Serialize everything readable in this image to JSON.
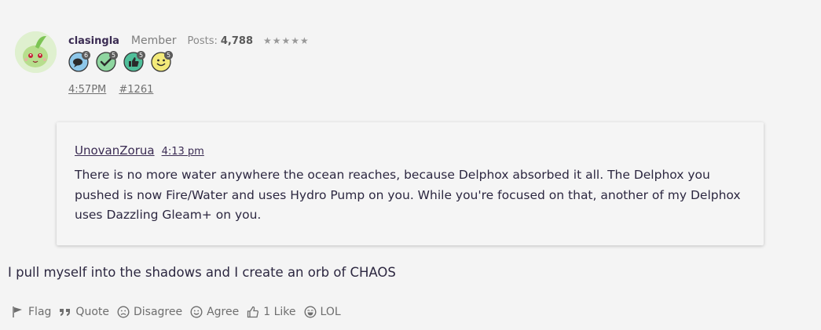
{
  "author": {
    "username": "clasingla",
    "role": "Member",
    "posts_label": "Posts:",
    "posts_value": "4,788",
    "stars": "★★★★★",
    "badges": [
      {
        "icon": "speech-bubble-icon",
        "count": "6",
        "color": "#8ec8ea"
      },
      {
        "icon": "checkmark-icon",
        "count": "5",
        "color": "#8fd6a0"
      },
      {
        "icon": "thumbs-up-icon",
        "count": "5",
        "color": "#4fbf9a"
      },
      {
        "icon": "smiley-face-icon",
        "count": "5",
        "color": "#f3ea7a"
      }
    ]
  },
  "meta": {
    "time": "4:57PM",
    "post_number": "#1261"
  },
  "quote": {
    "author": "UnovanZorua",
    "time": "4:13 pm",
    "text": "There is no more water anywhere the ocean reaches, because Delphox absorbed it all. The Delphox you pushed is now Fire/Water and uses Hydro Pump on you. While you're focused on that, another of my Delphox uses Dazzling Gleam+ on you."
  },
  "post_body": "I pull myself into the shadows and I create an orb of CHAOS",
  "actions": {
    "flag": "Flag",
    "quote": "Quote",
    "disagree": "Disagree",
    "agree": "Agree",
    "like": "1 Like",
    "lol": "LOL"
  }
}
